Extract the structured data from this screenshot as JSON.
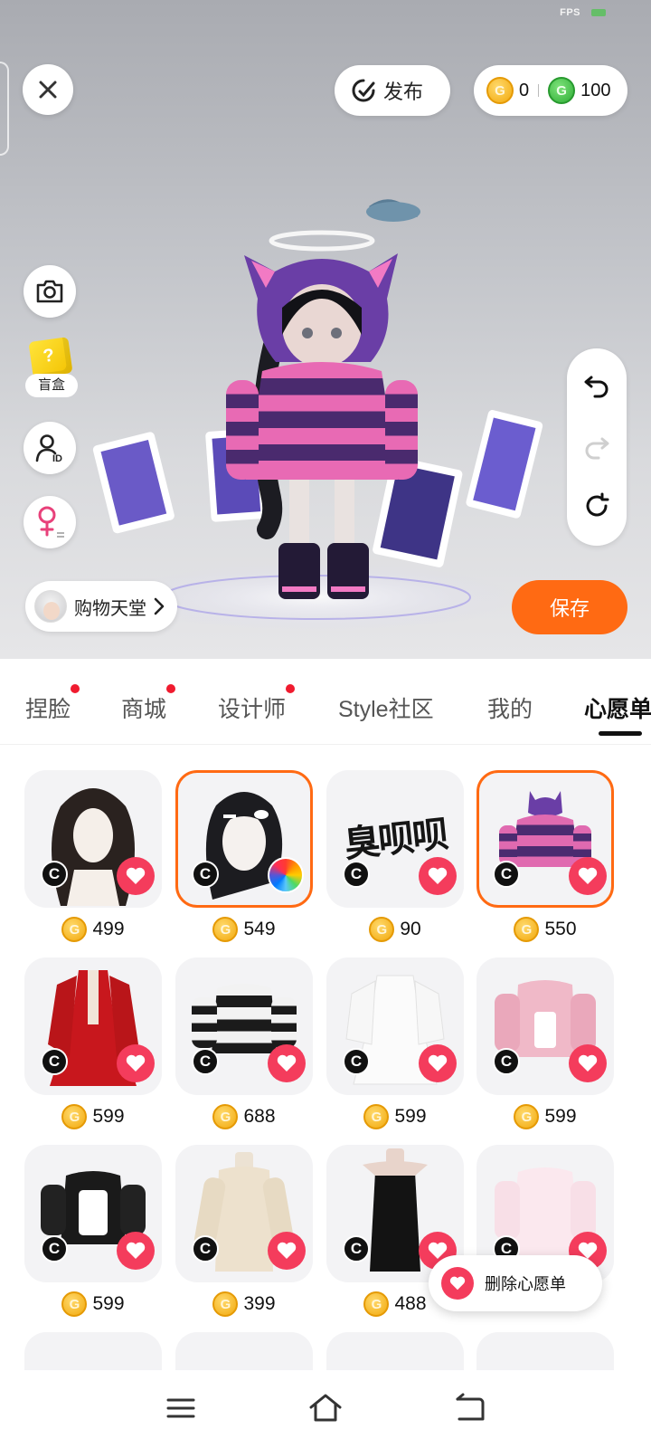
{
  "status": {
    "fps_label": "FPS"
  },
  "toolbar": {
    "publish_label": "发布",
    "gold_balance": "0",
    "green_balance": "100"
  },
  "side": {
    "blindbox_label": "盲盒"
  },
  "shop": {
    "label": "购物天堂"
  },
  "save_label": "保存",
  "tabs": [
    {
      "label": "捏脸",
      "dot": true
    },
    {
      "label": "商城",
      "dot": true
    },
    {
      "label": "设计师",
      "dot": true
    },
    {
      "label": "Style社区",
      "dot": false
    },
    {
      "label": "我的",
      "dot": false
    },
    {
      "label": "心愿单",
      "dot": false,
      "active": true
    }
  ],
  "items": [
    {
      "name": "hair-long-wavy",
      "price": "499",
      "selected": false,
      "badge": "C"
    },
    {
      "name": "hair-braid-clips",
      "price": "549",
      "selected": true,
      "badge": "C",
      "colorable": true
    },
    {
      "name": "text-sticker",
      "price": "90",
      "selected": false,
      "badge": "C",
      "text": "臭呗呗"
    },
    {
      "name": "cat-hoodie",
      "price": "550",
      "selected": true,
      "badge": "C"
    },
    {
      "name": "red-dress",
      "price": "599",
      "selected": false,
      "badge": "C"
    },
    {
      "name": "striped-sweater",
      "price": "688",
      "selected": false,
      "badge": "C"
    },
    {
      "name": "white-dress",
      "price": "599",
      "selected": false,
      "badge": "C"
    },
    {
      "name": "pink-jacket",
      "price": "599",
      "selected": false,
      "badge": "C"
    },
    {
      "name": "maid-outfit",
      "price": "599",
      "selected": false,
      "badge": "C"
    },
    {
      "name": "knit-dress",
      "price": "399",
      "selected": false,
      "badge": "C"
    },
    {
      "name": "black-dress",
      "price": "488",
      "selected": false,
      "badge": "C"
    },
    {
      "name": "pink-lace-dress",
      "price": "",
      "selected": false,
      "badge": "C"
    }
  ],
  "popup": {
    "remove_label": "删除心愿单"
  },
  "colors": {
    "accent": "#ff6a13",
    "heart": "#f43c5c",
    "tab_dot": "#f01b2f"
  }
}
